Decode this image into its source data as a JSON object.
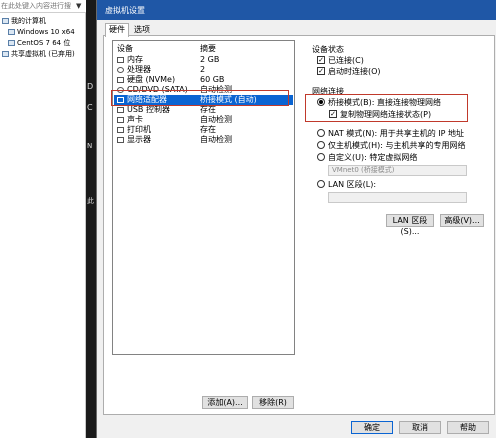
{
  "library": {
    "search_placeholder": "在此处键入内容进行搜索",
    "dropdown_glyph": "▼",
    "items": [
      {
        "label": "我的计算机",
        "indent": 1
      },
      {
        "label": "Windows 10 x64",
        "indent": 2
      },
      {
        "label": "CentOS 7 64 位",
        "indent": 2
      },
      {
        "label": "共享虚拟机 (已弃用)",
        "indent": 1
      }
    ]
  },
  "desktop_fragments": [
    "D",
    "C",
    "N",
    "此"
  ],
  "dialog": {
    "title": "虚拟机设置",
    "tabs": [
      "硬件",
      "选项"
    ],
    "device_columns": [
      "设备",
      "摘要"
    ],
    "devices": [
      {
        "name": "内存",
        "summary": "2 GB"
      },
      {
        "name": "处理器",
        "summary": "2"
      },
      {
        "name": "硬盘 (NVMe)",
        "summary": "60 GB"
      },
      {
        "name": "CD/DVD (SATA)",
        "summary": "自动检测"
      },
      {
        "name": "网络适配器",
        "summary": "桥接模式 (自动)",
        "selected": true
      },
      {
        "name": "USB 控制器",
        "summary": "存在"
      },
      {
        "name": "声卡",
        "summary": "自动检测"
      },
      {
        "name": "打印机",
        "summary": "存在"
      },
      {
        "name": "显示器",
        "summary": "自动检测"
      }
    ],
    "add_button": "添加(A)...",
    "remove_button": "移除(R)",
    "device_status": {
      "title": "设备状态",
      "connected": "已连接(C)",
      "connect_on_power": "启动时连接(O)"
    },
    "network": {
      "title": "网络连接",
      "bridged": "桥接模式(B): 直接连接物理网络",
      "replicate": "复制物理网络连接状态(P)",
      "nat": "NAT 模式(N): 用于共享主机的 IP 地址",
      "host_only": "仅主机模式(H): 与主机共享的专用网络",
      "custom": "自定义(U): 特定虚拟网络",
      "custom_value": "VMnet0 (桥接模式)",
      "lan_segment": "LAN 区段(L):"
    },
    "lan_segments_button": "LAN 区段(S)...",
    "advanced_button": "高级(V)...",
    "ok_button": "确定",
    "cancel_button": "取消",
    "help_button": "帮助"
  }
}
